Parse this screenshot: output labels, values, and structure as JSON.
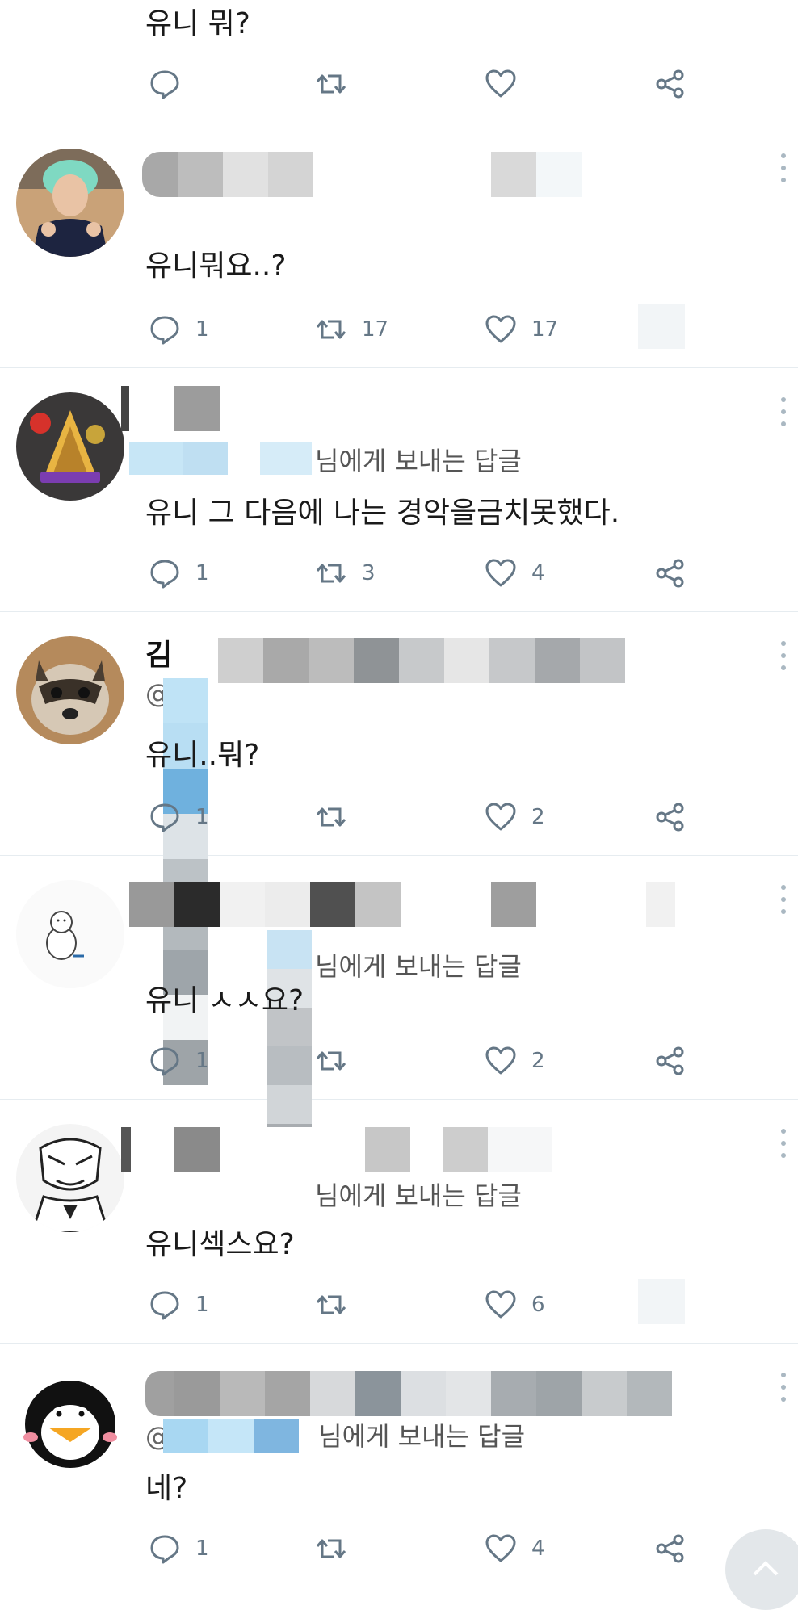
{
  "colors": {
    "icon": "#657786",
    "divider": "#e6ecf0",
    "text": "#1a1a1a",
    "blur_blue": "#9fd3f1"
  },
  "top_tweet": {
    "text": "유니 뭐?",
    "icons": [
      "reply-icon",
      "retweet-icon",
      "heart-icon",
      "share-icon"
    ]
  },
  "tweets": [
    {
      "avatar": "avatar-idol",
      "name_partial": "",
      "reply_partial": "",
      "text": "유니뭐요..?",
      "reply_count": "1",
      "retweet_count": "17",
      "like_count": "17"
    },
    {
      "avatar": "avatar-ancient-badge",
      "name_partial": "",
      "reply_partial": "님에게 보내는 답글",
      "text": "유니 그 다음에 나는 경악을금치못했다.",
      "reply_count": "1",
      "retweet_count": "3",
      "like_count": "4"
    },
    {
      "avatar": "avatar-raccoon",
      "name_partial": "김",
      "reply_partial": "@",
      "text": "유니..뭐?",
      "reply_count": "1",
      "retweet_count": "",
      "like_count": "2"
    },
    {
      "avatar": "avatar-bear",
      "name_partial": "",
      "reply_partial": "님에게 보내는 답글",
      "text": "유니 ㅅㅅ요?",
      "reply_count": "1",
      "retweet_count": "",
      "like_count": "2"
    },
    {
      "avatar": "avatar-sketch",
      "name_partial": "",
      "reply_partial": "님에게 보내는 답글",
      "text": "유니섹스요?",
      "reply_count": "1",
      "retweet_count": "",
      "like_count": "6"
    },
    {
      "avatar": "avatar-penguin",
      "name_partial": "",
      "reply_partial": "님에게 보내는 답글",
      "text": "네?",
      "reply_count": "1",
      "retweet_count": "",
      "like_count": "4"
    }
  ],
  "scroll_top_icon": "chevron-up-icon"
}
